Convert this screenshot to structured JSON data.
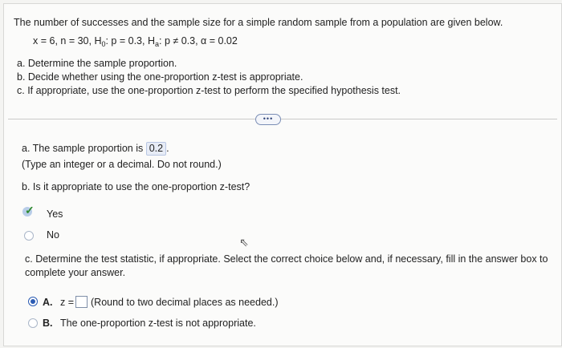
{
  "problem": {
    "intro": "The number of successes and the sample size for a simple random sample from a population are given below.",
    "given": {
      "pre": "x = 6, n = 30, H",
      "h0_sub": "0",
      "mid": ": p = 0.3, H",
      "ha_sub": "a",
      "post": ": p ≠ 0.3, α = 0.02"
    },
    "tasks": [
      "a. Determine the sample proportion.",
      "b. Decide whether using the one-proportion z-test is appropriate.",
      "c. If appropriate, use the one-proportion z-test to perform the specified hypothesis test."
    ]
  },
  "more_button": "•••",
  "part_a": {
    "prompt": "a. The sample proportion is",
    "answer": "0.2",
    "period": ".",
    "hint": "(Type an integer or a decimal. Do not round.)"
  },
  "part_b": {
    "question": "b. Is it appropriate to use the one-proportion z-test?",
    "options": [
      "Yes",
      "No"
    ]
  },
  "part_c": {
    "prompt_line1": "c. Determine the test statistic, if appropriate. Select the correct choice below and, if necessary, fill in the answer box to",
    "prompt_line2": "complete your answer.",
    "option_a": {
      "letter": "A.",
      "lhs": "z =",
      "note": "(Round to two decimal places as needed.)"
    },
    "option_b": {
      "letter": "B.",
      "text": "The one-proportion z-test is not appropriate."
    }
  }
}
